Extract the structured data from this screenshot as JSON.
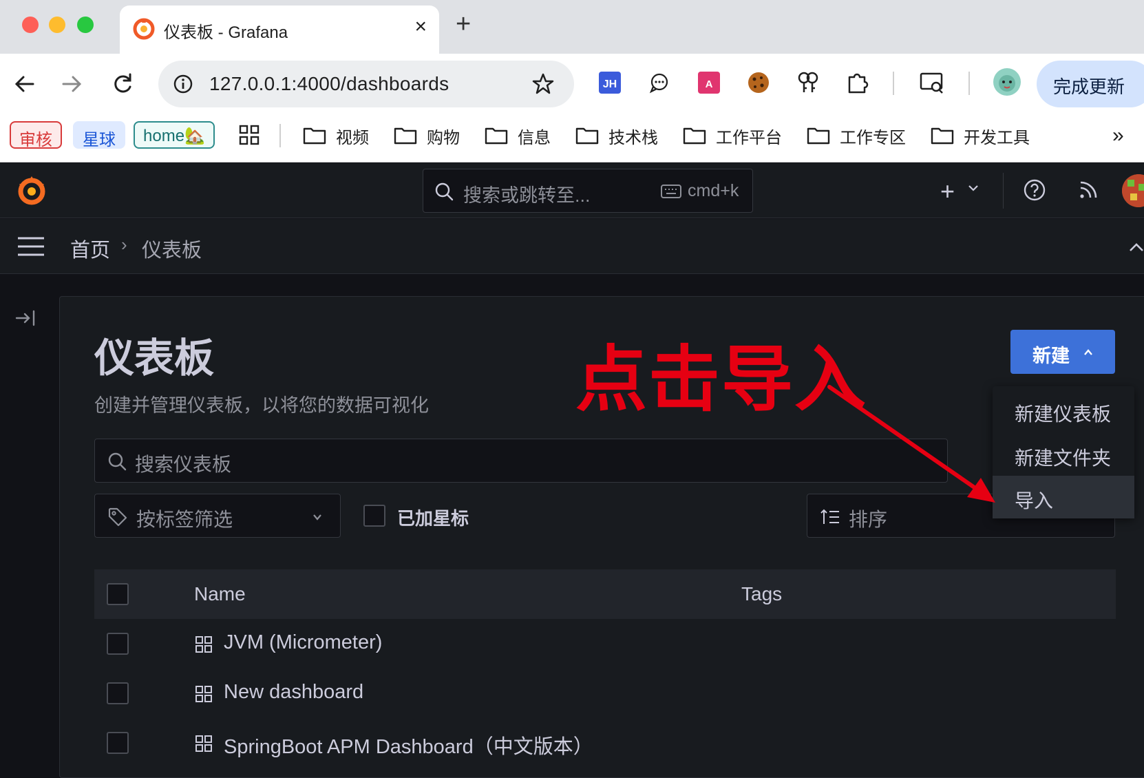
{
  "browser": {
    "tab_title": "仪表板 - Grafana",
    "tab_close": "×",
    "new_tab": "+",
    "url": "127.0.0.1:4000/dashboards",
    "update_button": "完成更新",
    "more": "⋮",
    "extensions": [
      "jh-extension-icon",
      "chat-extension-icon",
      "translate-extension-icon",
      "cookie-extension-icon",
      "keys-extension-icon",
      "puzzle-extensions-icon",
      "screen-search-icon",
      "profile-avatar"
    ]
  },
  "bookmarks": {
    "chips": [
      "审核",
      "星球",
      "home🏡"
    ],
    "folders": [
      "视频",
      "购物",
      "信息",
      "技术栈",
      "工作平台",
      "工作专区",
      "开发工具"
    ],
    "more": "»"
  },
  "grafana": {
    "search_placeholder": "搜索或跳转至...",
    "search_shortcut": "cmd+k",
    "plus": "+",
    "breadcrumb": {
      "home": "首页",
      "separator": "›",
      "current": "仪表板"
    },
    "page": {
      "title": "仪表板",
      "subtitle": "创建并管理仪表板，以将您的数据可视化"
    },
    "new_button": "新建",
    "new_menu": [
      "新建仪表板",
      "新建文件夹",
      "导入"
    ],
    "search_dashboards_placeholder": "搜索仪表板",
    "tag_filter": "按标签筛选",
    "starred_label": "已加星标",
    "sort_label": "排序",
    "table": {
      "columns": [
        "Name",
        "Tags"
      ],
      "rows": [
        "JVM (Micrometer)",
        "New dashboard",
        "SpringBoot APM Dashboard（中文版本）"
      ]
    }
  },
  "annotation": {
    "text": "点击导入",
    "color": "#e60012"
  },
  "colors": {
    "grafana_bg": "#111217",
    "panel_bg": "#181b1f",
    "primary_button": "#3d71d9"
  }
}
